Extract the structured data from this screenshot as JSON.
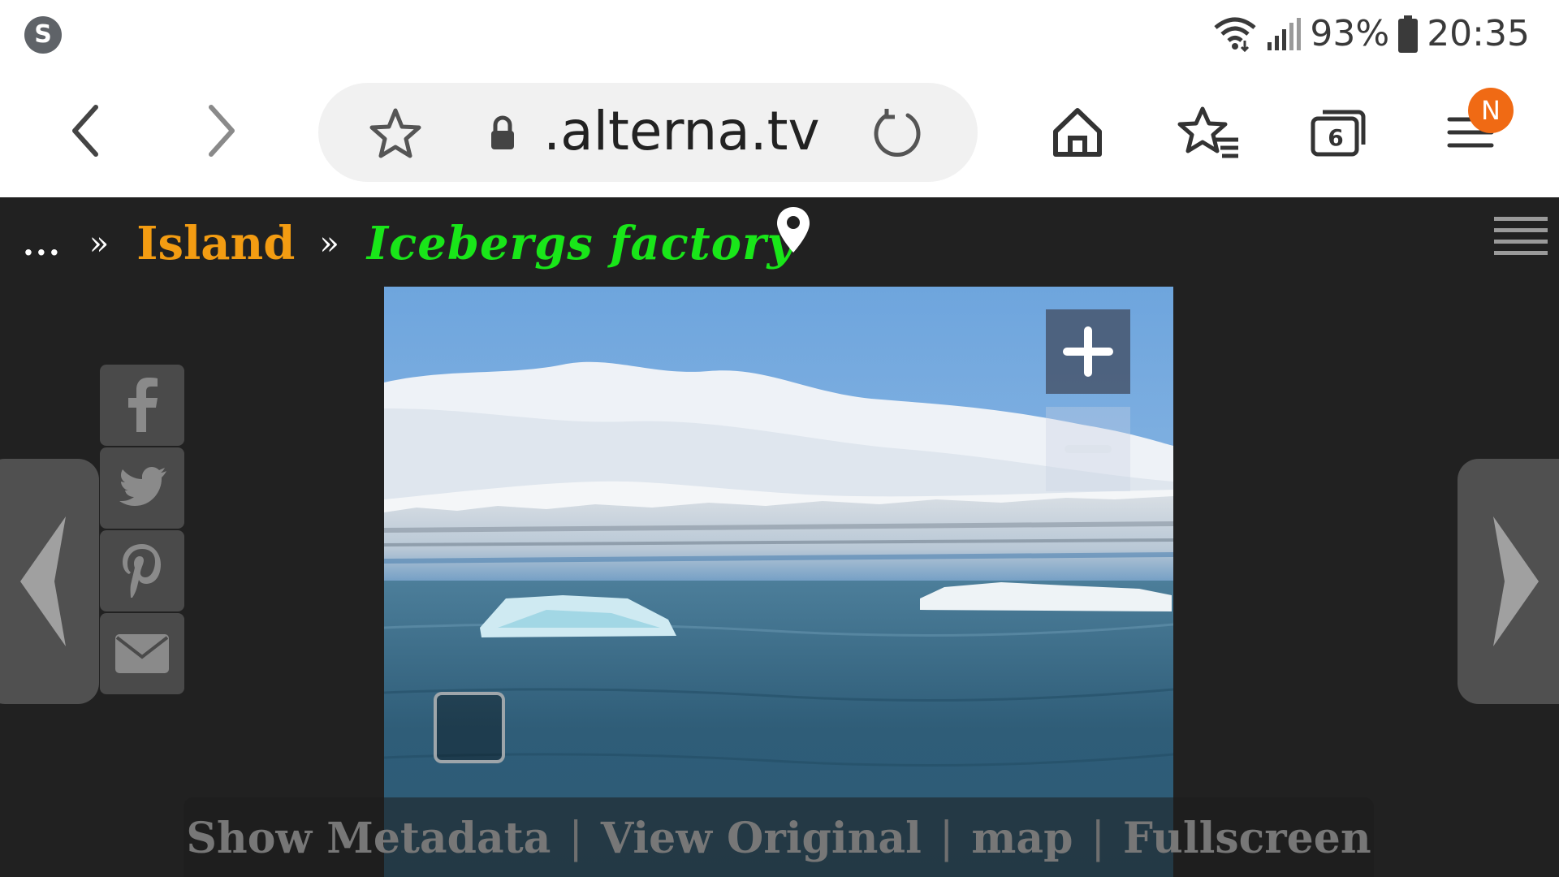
{
  "status_bar": {
    "app_icon_letter": "S",
    "battery": "93%",
    "time": "20:35"
  },
  "browser": {
    "url": " .alterna.tv",
    "tab_count": "6",
    "menu_badge": "N"
  },
  "breadcrumb": {
    "ellipsis": "...",
    "separator": "»",
    "parent": "Island",
    "current": "Icebergs factory"
  },
  "image_controls": {
    "zoom_in": "+",
    "zoom_out": "−"
  },
  "bottom_links": {
    "show_metadata": "Show Metadata",
    "view_original": "View Original",
    "map": "map",
    "fullscreen": "Fullscreen",
    "separator": "|"
  },
  "colors": {
    "page_bg": "#212121",
    "breadcrumb_parent": "#f39c12",
    "breadcrumb_current": "#19e619",
    "badge": "#f06a14"
  }
}
